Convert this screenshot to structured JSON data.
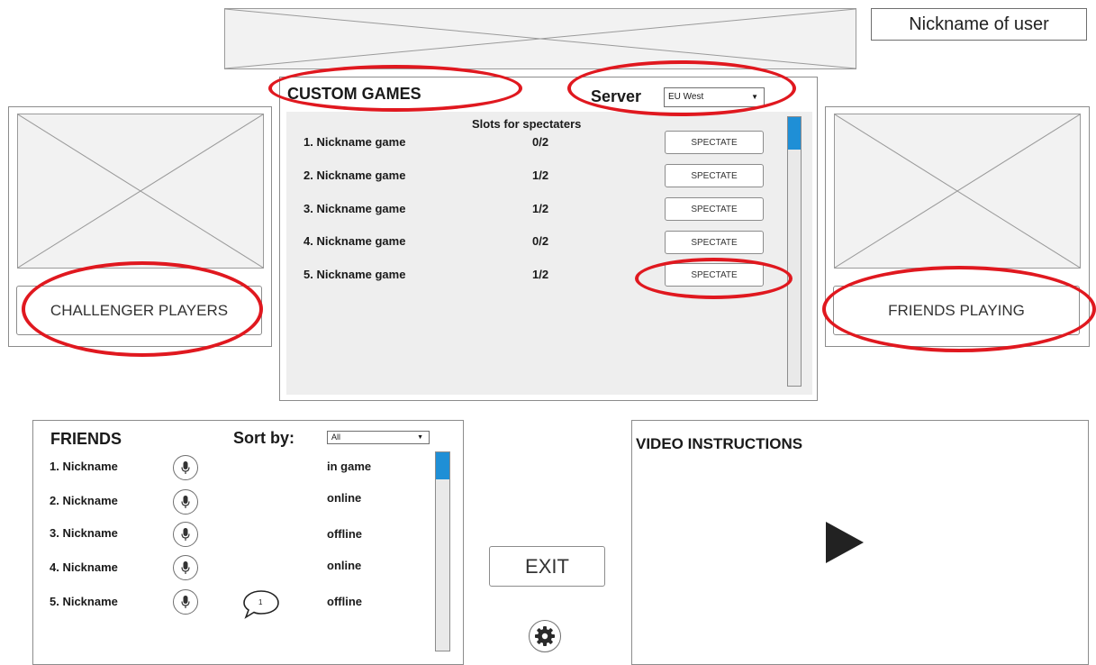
{
  "header": {
    "nickname_label": "Nickname of user"
  },
  "custom_games": {
    "title": "CUSTOM GAMES",
    "server_label": "Server",
    "server_value": "EU West",
    "slots_header": "Slots for spectaters",
    "games": [
      {
        "name": "1. Nickname game",
        "slots": "0/2",
        "action": "SPECTATE"
      },
      {
        "name": "2. Nickname game",
        "slots": "1/2",
        "action": "SPECTATE"
      },
      {
        "name": "3. Nickname game",
        "slots": "1/2",
        "action": "SPECTATE"
      },
      {
        "name": "4. Nickname game",
        "slots": "0/2",
        "action": "SPECTATE"
      },
      {
        "name": "5. Nickname game",
        "slots": "1/2",
        "action": "SPECTATE"
      }
    ]
  },
  "left_panel": {
    "button_label": "CHALLENGER PLAYERS"
  },
  "right_panel": {
    "button_label": "FRIENDS PLAYING"
  },
  "friends": {
    "title": "FRIENDS",
    "sort_label": "Sort by:",
    "sort_value": "All",
    "items": [
      {
        "name": "1. Nickname",
        "status": "in game"
      },
      {
        "name": "2. Nickname",
        "status": "online"
      },
      {
        "name": "3. Nickname",
        "status": "offline"
      },
      {
        "name": "4. Nickname",
        "status": "online"
      },
      {
        "name": "5. Nickname",
        "status": "offline"
      }
    ],
    "chat_badge": "1"
  },
  "exit_label": "EXIT",
  "video": {
    "title": "VIDEO INSTRUCTIONS"
  },
  "colors": {
    "annotation_red": "#e0181f",
    "scroll_accent": "#1f8fd6"
  }
}
